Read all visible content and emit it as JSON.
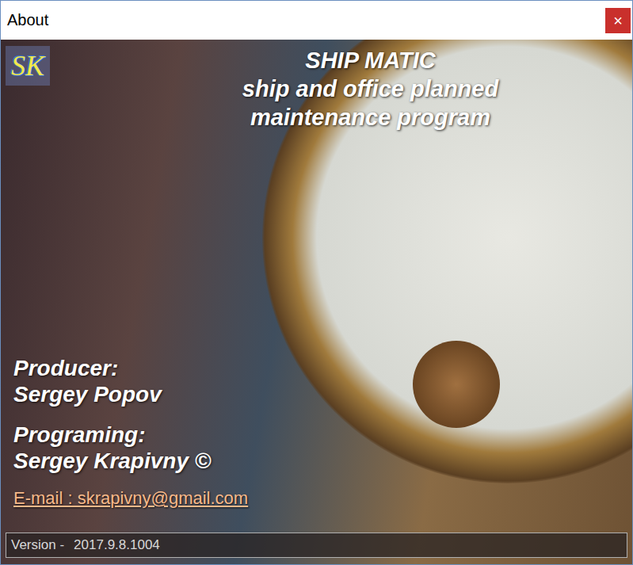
{
  "window": {
    "title": "About",
    "close": "×"
  },
  "logo": {
    "text": "SK"
  },
  "heading": {
    "lines": [
      "SHIP MATIC",
      "ship and office planned",
      "maintenance program"
    ]
  },
  "credits": [
    {
      "label": "Producer:",
      "name": "Sergey Popov"
    },
    {
      "label": "Programing:",
      "name": "Sergey Krapivny ©"
    }
  ],
  "email": "E-mail : skrapivny@gmail.com",
  "version": {
    "label": "Version -",
    "value": "2017.9.8.1004"
  }
}
